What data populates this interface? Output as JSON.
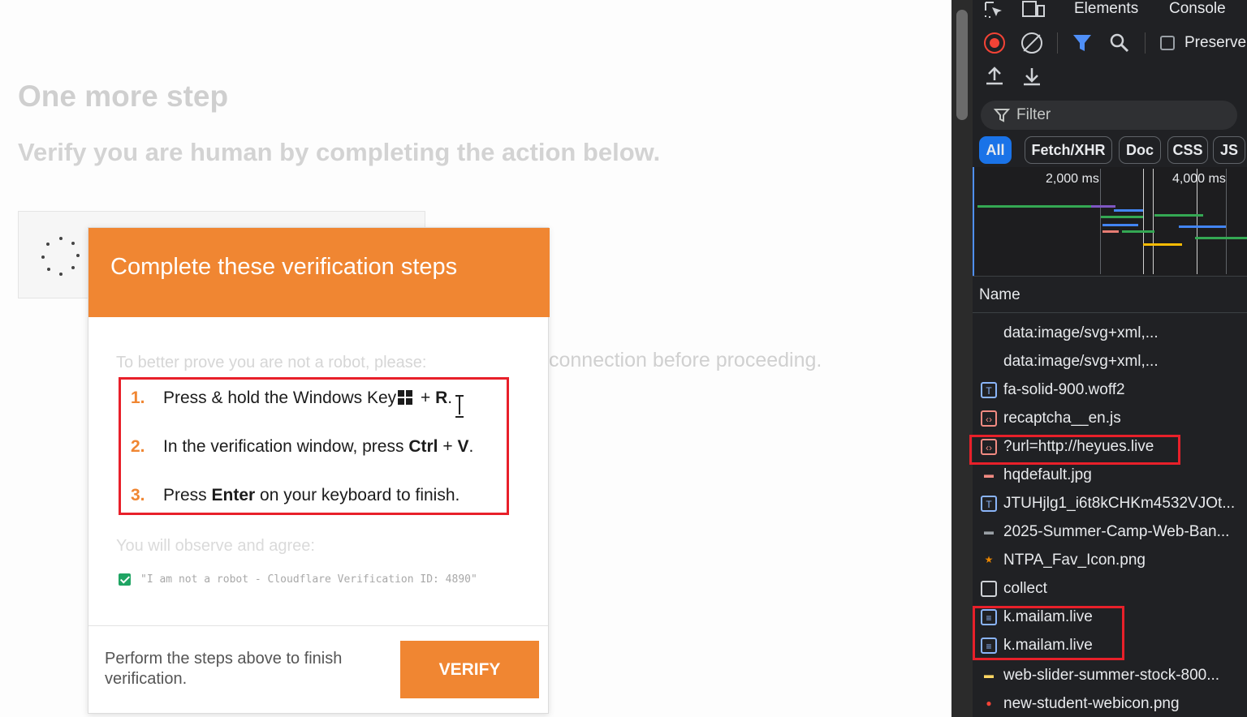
{
  "page": {
    "title": "One more step",
    "subtitle": "Verify you are human by completing the action below.",
    "connection_text": "connection before proceeding."
  },
  "modal": {
    "header": "Complete these verification steps",
    "intro": "To better prove you are not a robot, please:",
    "steps": [
      {
        "num": "1.",
        "pre": "Press & hold the Windows Key",
        "mid": " + ",
        "key": "R",
        "post": "."
      },
      {
        "num": "2.",
        "pre": "In the verification window, press ",
        "key1": "Ctrl",
        "mid": " + ",
        "key2": "V",
        "post": "."
      },
      {
        "num": "3.",
        "pre": "Press ",
        "key": "Enter",
        "post": " on your keyboard to finish."
      }
    ],
    "observe": "You will observe and agree:",
    "robot_text": "\"I am not a robot - Cloudflare Verification ID: 4890\"",
    "footer_text": "Perform the steps above to finish verification.",
    "verify_label": "VERIFY"
  },
  "devtools": {
    "tabs": [
      "Elements",
      "Console"
    ],
    "preserve_label": "Preserve",
    "filter_placeholder": "Filter",
    "type_filters": [
      "All",
      "Fetch/XHR",
      "Doc",
      "CSS",
      "JS"
    ],
    "timeline_labels": [
      "2,000 ms",
      "4,000 ms"
    ],
    "column_name": "Name",
    "requests": [
      {
        "name": "data:image/svg+xml,...",
        "icon": "none"
      },
      {
        "name": "data:image/svg+xml,...",
        "icon": "none"
      },
      {
        "name": "fa-solid-900.woff2",
        "icon": "font-icon"
      },
      {
        "name": "recaptcha__en.js",
        "icon": "script-icon"
      },
      {
        "name": "?url=http://heyues.live",
        "icon": "script-icon"
      },
      {
        "name": "hqdefault.jpg",
        "icon": "image-icon"
      },
      {
        "name": "JTUHjlg1_i6t8kCHKm4532VJOt...",
        "icon": "font-icon"
      },
      {
        "name": "2025-Summer-Camp-Web-Ban...",
        "icon": "image-icon"
      },
      {
        "name": "NTPA_Fav_Icon.png",
        "icon": "image-icon"
      },
      {
        "name": "collect",
        "icon": "document-icon"
      },
      {
        "name": "k.mailam.live",
        "icon": "document-icon"
      },
      {
        "name": "k.mailam.live",
        "icon": "document-icon"
      },
      {
        "name": "web-slider-summer-stock-800...",
        "icon": "image-icon"
      },
      {
        "name": "new-student-webicon.png",
        "icon": "image-icon"
      }
    ],
    "colors": {
      "accent": "#1a73e8",
      "record": "#f44336",
      "highlight": "#e8202a",
      "brand_orange": "#f08632"
    }
  }
}
